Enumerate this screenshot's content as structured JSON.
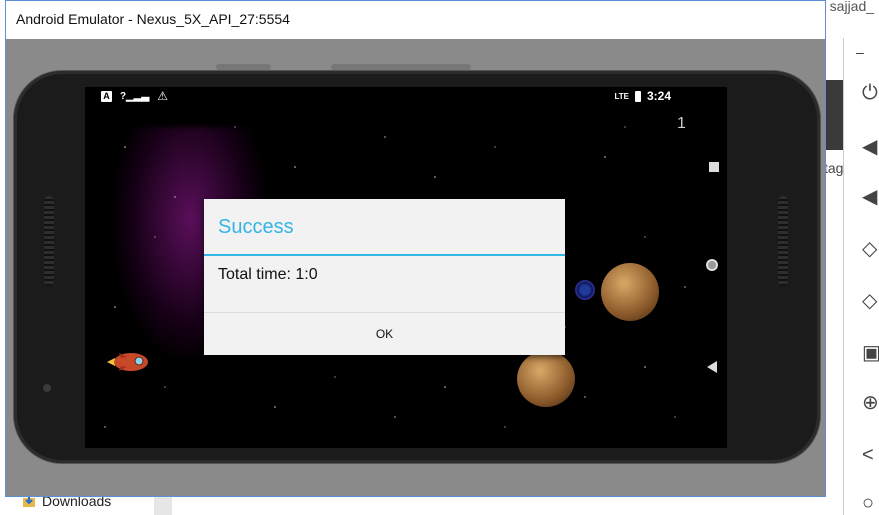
{
  "background": {
    "title_fragment": "n sajjad_",
    "side_text": "tag",
    "downloads_label": "Downloads"
  },
  "window": {
    "title": "Android Emulator - Nexus_5X_API_27:5554"
  },
  "statusbar": {
    "time": "3:24",
    "network": "LTE"
  },
  "game": {
    "score": "1"
  },
  "dialog": {
    "title": "Success",
    "message": "Total time: 1:0",
    "ok_label": "OK"
  },
  "colors": {
    "dialog_accent": "#33b5e5",
    "window_border": "#5b8fd6"
  },
  "toolbar": {
    "minimize_label": "–",
    "icons": [
      "power-icon",
      "volume-up-icon",
      "volume-down-icon",
      "rotate-left-icon",
      "rotate-right-icon",
      "camera-icon",
      "zoom-icon",
      "back-icon",
      "more-icon"
    ]
  }
}
